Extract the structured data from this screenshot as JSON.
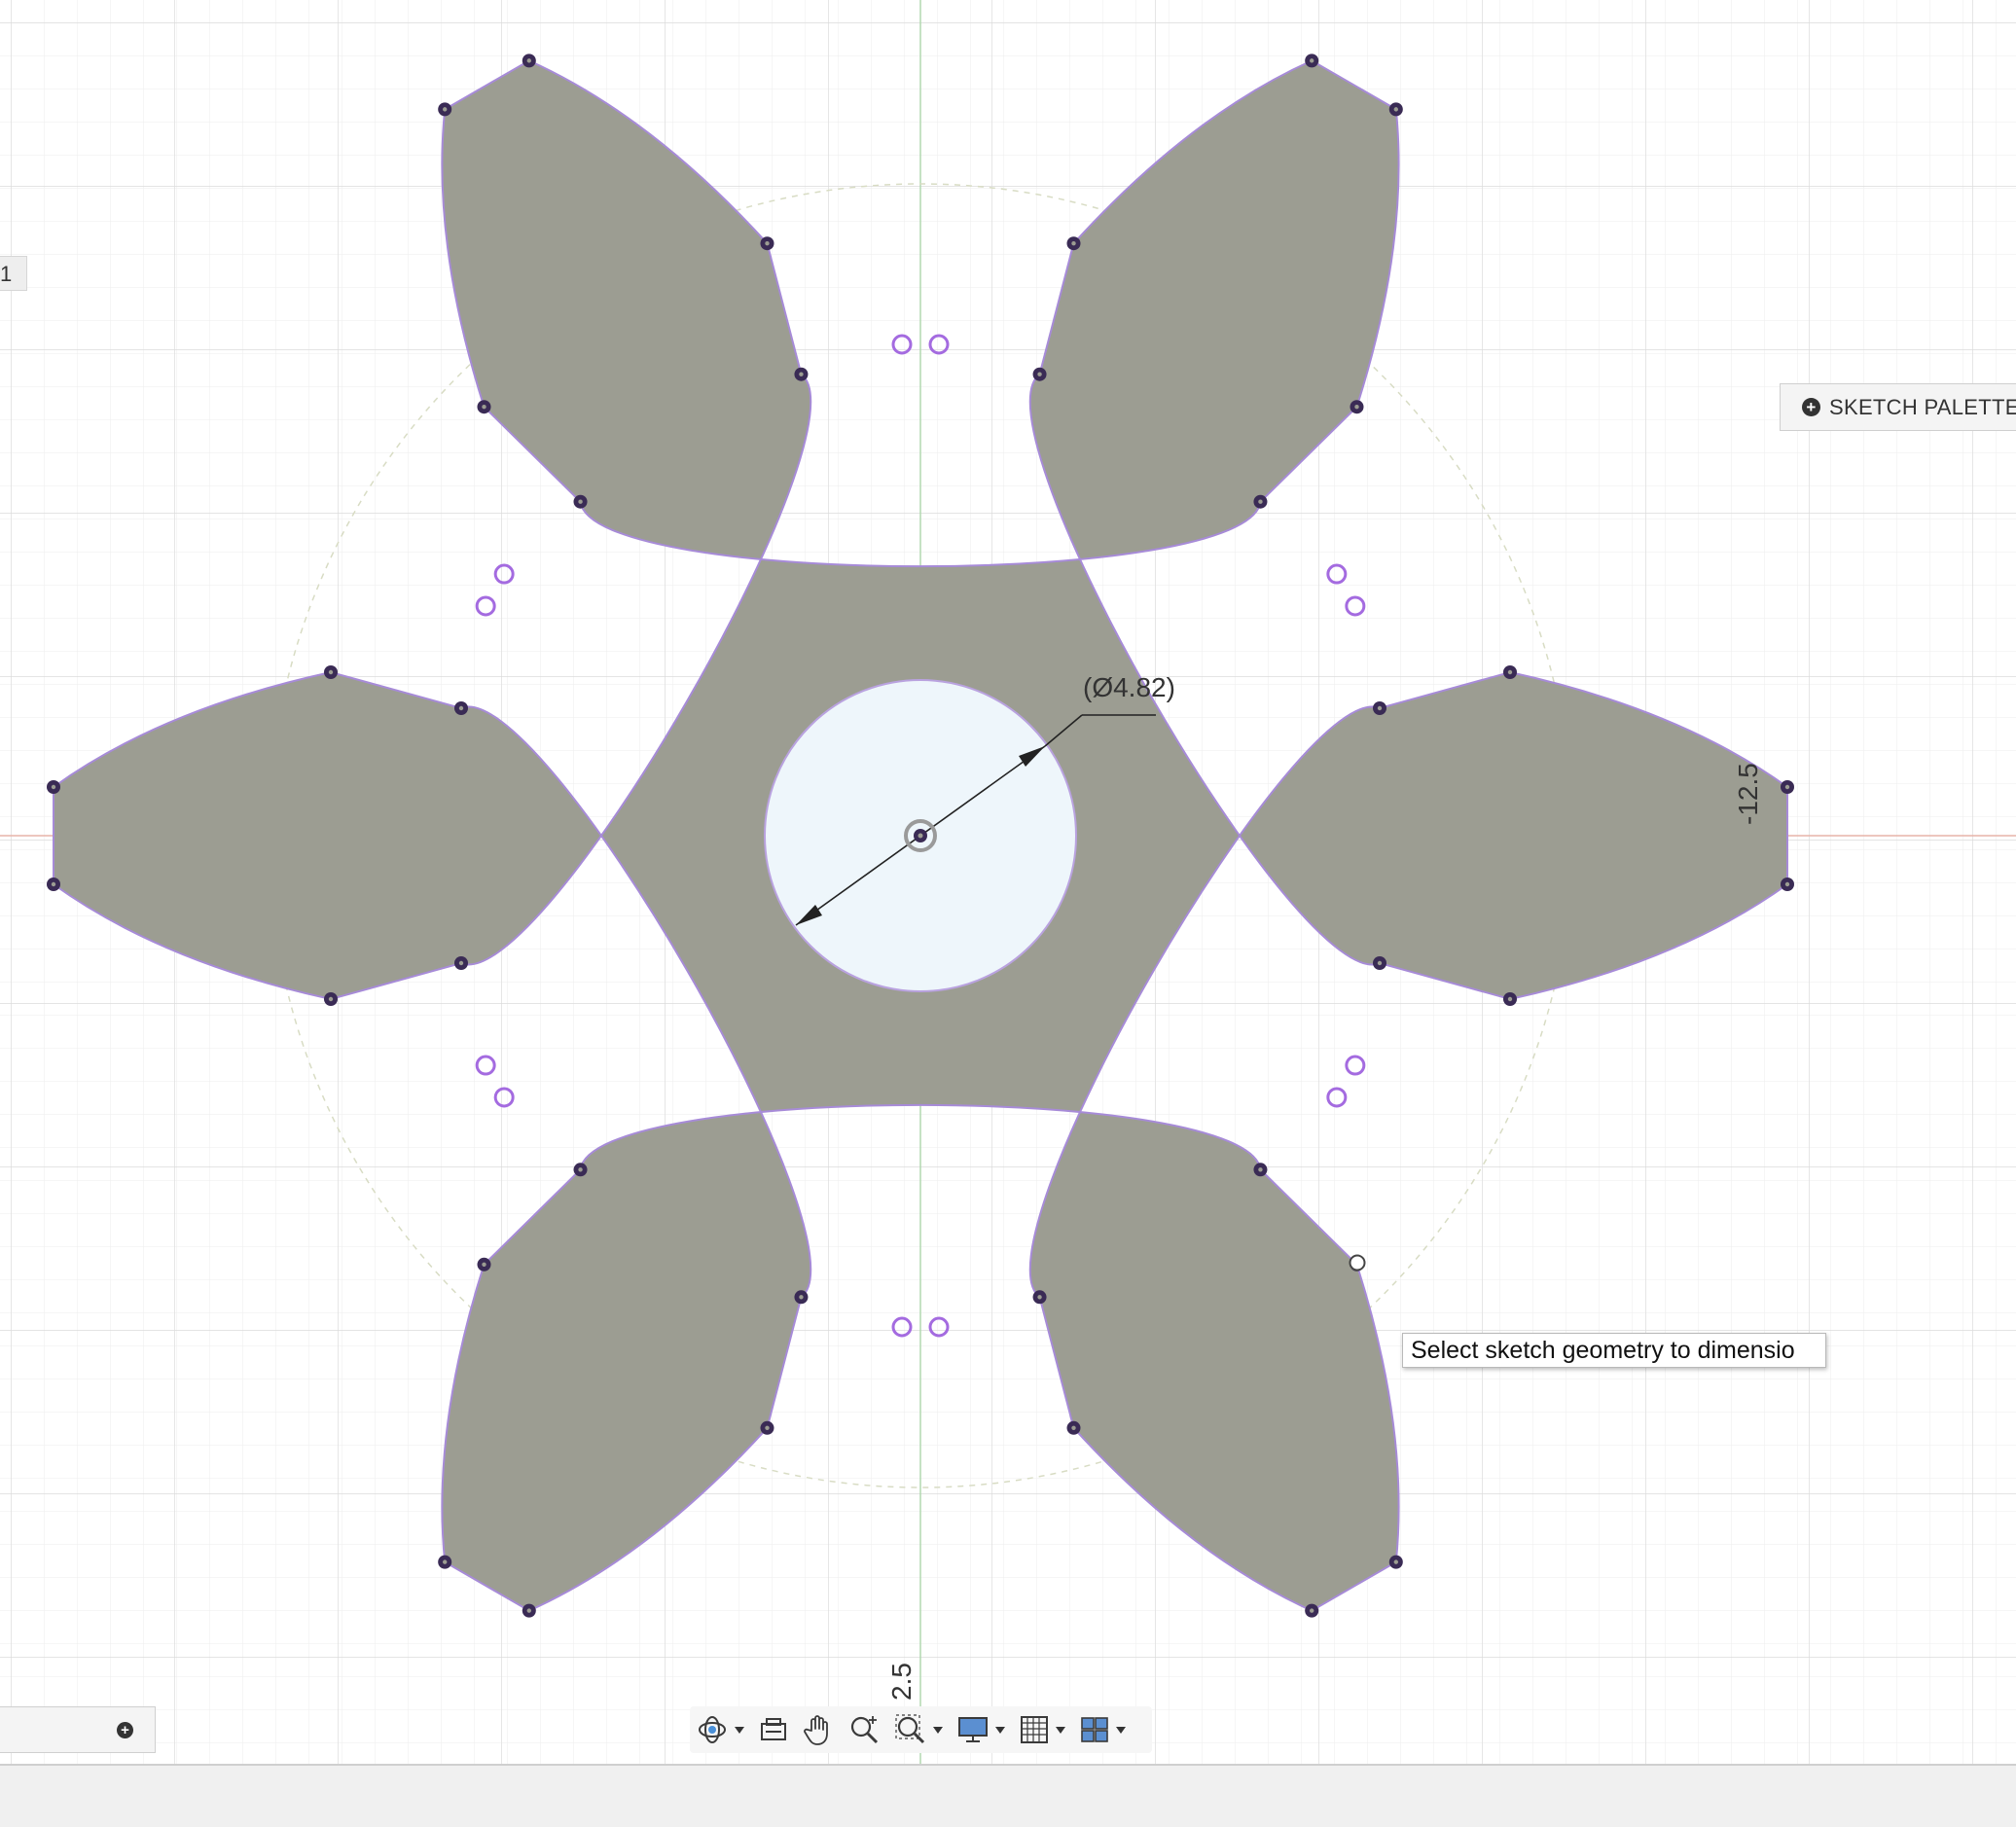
{
  "app": {
    "left_tab_label": "1",
    "sketch_palette_label": "SKETCH PALETTE",
    "tooltip_text": "Select sketch geometry to dimensio"
  },
  "dimensions": {
    "diameter_label": "(Ø4.82)",
    "right_label": "-12.5",
    "bottom_label": "2.5"
  },
  "nav_toolbar": {
    "tools": [
      {
        "name": "orbit-icon",
        "has_dropdown": true
      },
      {
        "name": "look-at-icon",
        "has_dropdown": false
      },
      {
        "name": "pan-icon",
        "has_dropdown": false
      },
      {
        "name": "zoom-icon",
        "has_dropdown": false
      },
      {
        "name": "zoom-window-icon",
        "has_dropdown": true
      },
      {
        "name": "display-settings-icon",
        "has_dropdown": true
      },
      {
        "name": "grid-settings-icon",
        "has_dropdown": true
      },
      {
        "name": "viewports-icon",
        "has_dropdown": true
      }
    ]
  },
  "colors": {
    "profile_fill": "#9c9d92",
    "profile_edge": "#a78bd8",
    "hole_fill": "#eef6fb",
    "point_fill": "#3a2b55",
    "constraint_ring": "#a46be0",
    "grid_minor": "#eeeeee",
    "grid_major": "#dcdcdc",
    "axis_x": "#e7b4a8",
    "axis_y": "#b2d8b0"
  }
}
